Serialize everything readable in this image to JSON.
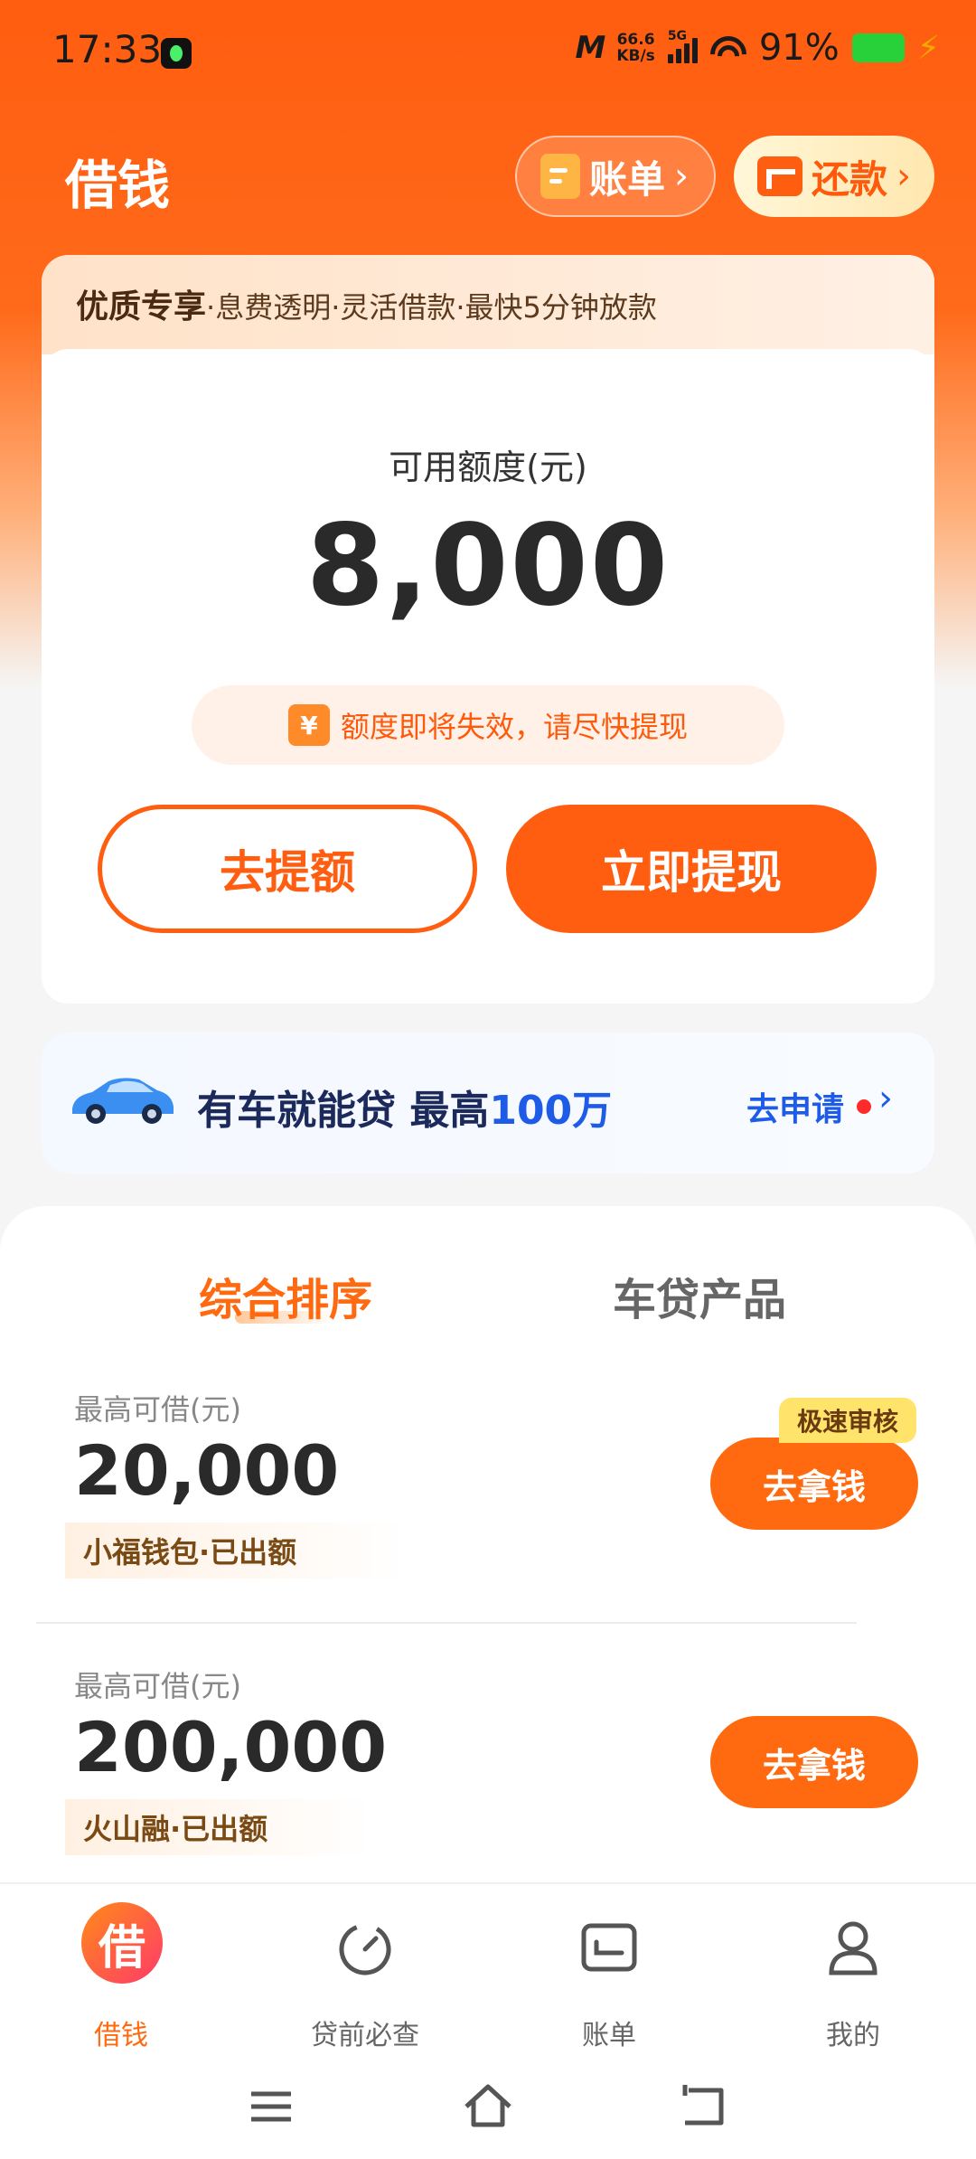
{
  "status_bar": {
    "time": "17:33",
    "net_speed_value": "66.6",
    "net_speed_unit": "KB/s",
    "network": "5G",
    "battery_percent": "91%",
    "icons": [
      "music-app-icon",
      "mi-icon",
      "signal-icon",
      "wifi-icon",
      "battery-icon",
      "charging-icon"
    ]
  },
  "header": {
    "title": "借钱",
    "bill_button": "账单",
    "repay_button": "还款"
  },
  "main_card": {
    "banner_bold": "优质专享",
    "banner_text": "·息费透明·灵活借款·最快5分钟放款",
    "quota_label": "可用额度(元)",
    "quota_value": "8,000",
    "notice_icon": "¥",
    "notice_text": "额度即将失效，请尽快提现",
    "raise_button": "去提额",
    "withdraw_button": "立即提现"
  },
  "car_banner": {
    "text_prefix": "有车就能贷 最高",
    "text_highlight": "100万",
    "apply": "去申请"
  },
  "tabs": [
    "综合排序",
    "车贷产品"
  ],
  "products": [
    {
      "label": "最高可借(元)",
      "amount": "20,000",
      "tag": "小福钱包·已出额",
      "badge": "极速审核",
      "button": "去拿钱"
    },
    {
      "label": "最高可借(元)",
      "amount": "200,000",
      "tag": "火山融·已出额",
      "button": "去拿钱"
    }
  ],
  "bottom_nav": [
    {
      "icon_char": "借",
      "label": "借钱",
      "active": true
    },
    {
      "label": "贷前必查"
    },
    {
      "label": "账单"
    },
    {
      "label": "我的"
    }
  ],
  "colors": {
    "brand_orange": "#ff5d10",
    "accent_blue": "#1e5ce8",
    "badge_yellow": "#ffe36a"
  }
}
